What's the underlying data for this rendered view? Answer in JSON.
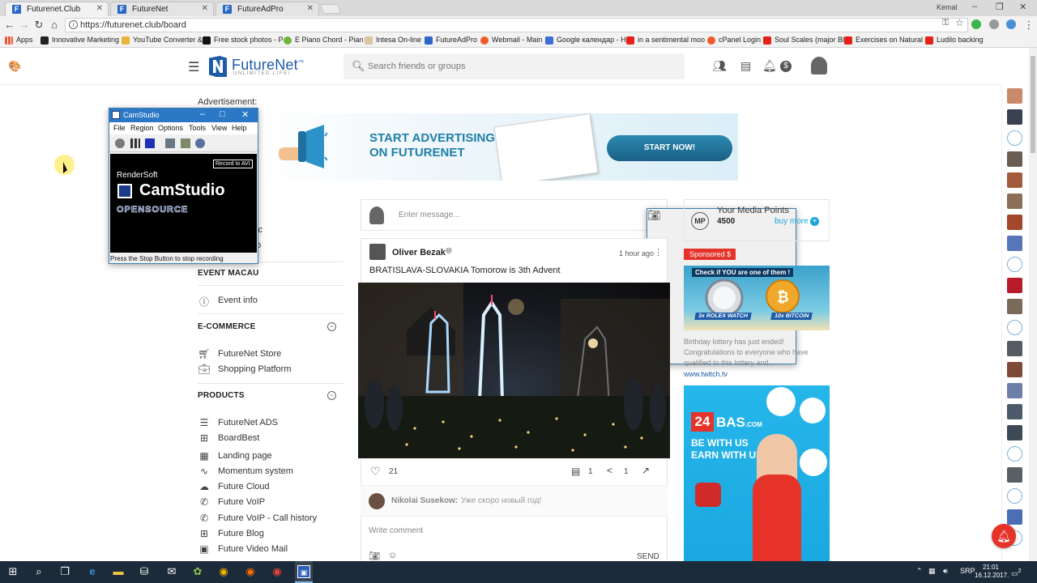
{
  "browser": {
    "tabs": [
      {
        "label": "Futurenet.Club",
        "active": true
      },
      {
        "label": "FutureNet",
        "active": false
      },
      {
        "label": "FutureAdPro",
        "active": false
      }
    ],
    "window_user": "Kemal",
    "url": "https://futurenet.club/board",
    "bookmarks": [
      {
        "label": "Apps"
      },
      {
        "label": "Innovative Marketing"
      },
      {
        "label": "YouTube Converter &"
      },
      {
        "label": "Free stock photos - P"
      },
      {
        "label": "E Piano Chord - Pian"
      },
      {
        "label": "Intesa On-line"
      },
      {
        "label": "FutureAdPro"
      },
      {
        "label": "Webmail - Main"
      },
      {
        "label": "Google календар - H"
      },
      {
        "label": "in a sentimental moo"
      },
      {
        "label": "cPanel Login"
      },
      {
        "label": "Soul Scales (major Bl"
      },
      {
        "label": "Exercises on Natural"
      },
      {
        "label": "Ludilo backing"
      }
    ]
  },
  "header": {
    "logo_name": "FutureNet",
    "logo_tm": "™",
    "logo_tagline": "UNLIMITED LIFE!",
    "search_placeholder": "Search friends or groups"
  },
  "sidebar": {
    "ad_label": "Advertisement:",
    "partial_items": [
      "ic",
      "p"
    ],
    "sections": [
      {
        "title": "EVENT MACAU",
        "items": [
          {
            "label": "Event info",
            "icon": "info-icon"
          }
        ]
      },
      {
        "title": "E-COMMERCE",
        "items": [
          {
            "label": "FutureNet Store",
            "icon": "cart-icon"
          },
          {
            "label": "Shopping Platform",
            "icon": "briefcase-icon"
          }
        ]
      },
      {
        "title": "PRODUCTS",
        "items": [
          {
            "label": "FutureNet ADS",
            "icon": "list-icon"
          },
          {
            "label": "BoardBest",
            "icon": "board-icon"
          },
          {
            "label": "Landing page",
            "icon": "grid-icon"
          },
          {
            "label": "Momentum system",
            "icon": "trend-icon"
          },
          {
            "label": "Future Cloud",
            "icon": "cloud-icon"
          },
          {
            "label": "Future VoIP",
            "icon": "phone-icon"
          },
          {
            "label": "Future VoIP - Call history",
            "icon": "phone-history-icon"
          },
          {
            "label": "Future Blog",
            "icon": "blog-icon"
          },
          {
            "label": "Future Video Mail",
            "icon": "video-icon"
          }
        ]
      }
    ],
    "collapse_glyph": "−"
  },
  "banner": {
    "line1": "START ADVERTISING",
    "line2": "ON FUTURENET",
    "cta": "START NOW!"
  },
  "composer": {
    "placeholder": "Enter message..."
  },
  "post": {
    "author": "Oliver Bezak",
    "time": "1 hour ago",
    "text": "BRATISLAVA-SLOVAKIA Tomorow is 3th Advent",
    "likes": "21",
    "comments": "1",
    "shares": "1",
    "comment": {
      "author": "Nikolai Susekow:",
      "text": "Уже скоро новый год!"
    },
    "write_placeholder": "Write comment",
    "send_label": "SEND"
  },
  "media_points": {
    "badge": "MP",
    "title": "Your Media Points",
    "value": "4500",
    "buy_more": "buy more"
  },
  "sponsored": {
    "label": "Sponsored",
    "count": "$",
    "img1_heading": "Check if YOU are one of them !",
    "img1_left": "3x ROLEX WATCH",
    "img1_right": "10x BITCOIN",
    "description": "Birthday lottery has just ended! Congratulations to everyone who have qualified to this lottery and...",
    "link": "www.twitch.tv",
    "img2_brand_num": "24",
    "img2_brand_name": "BAS",
    "img2_brand_tld": ".COM",
    "img2_line1": "BE WITH US",
    "img2_line2": "EARN WITH US"
  },
  "camstudio": {
    "title": "CamStudio",
    "menu": [
      "File",
      "Region",
      "Options",
      "Tools",
      "View",
      "Help"
    ],
    "brand_small": "RenderSoft",
    "brand_big": "CamStudio",
    "brand_open": "OPENSOURCE",
    "record_label": "Record to AVI",
    "status": "Press the Stop Button to stop recording"
  },
  "taskbar": {
    "lang": "SRP",
    "time": "21:01",
    "date": "16.12.2017.",
    "notif_count": "2"
  },
  "colors": {
    "brand_blue": "#1d5aa8",
    "accent_cyan": "#1aa3d9",
    "sponsored_red": "#e5332a",
    "taskbar": "#1c2b3a"
  }
}
